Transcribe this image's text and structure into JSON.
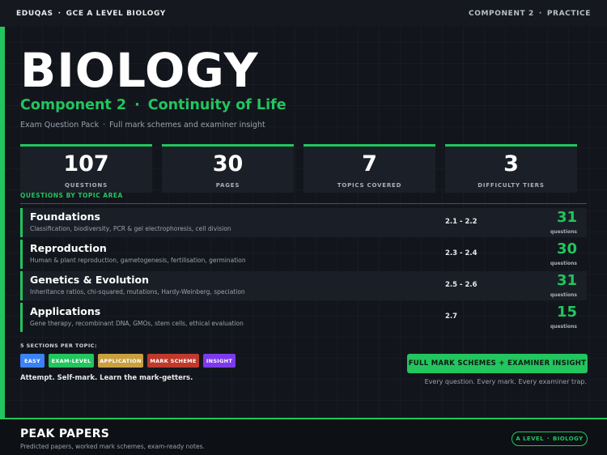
{
  "topbar": {
    "left_a": "EDUQAS",
    "left_b": "GCE A LEVEL BIOLOGY",
    "right_a": "COMPONENT 2",
    "right_b": "PRACTICE",
    "separator": "·"
  },
  "hero": {
    "title": "BIOLOGY",
    "subtitle_a": "Component 2",
    "subtitle_b": "Continuity of Life",
    "tagline_a": "Exam Question Pack",
    "tagline_b": "Full mark schemes and examiner insight"
  },
  "stats": [
    {
      "value": "107",
      "label": "QUESTIONS"
    },
    {
      "value": "30",
      "label": "PAGES"
    },
    {
      "value": "7",
      "label": "TOPICS COVERED"
    },
    {
      "value": "3",
      "label": "DIFFICULTY TIERS"
    }
  ],
  "topics_heading": "QUESTIONS BY TOPIC AREA",
  "topics": [
    {
      "name": "Foundations",
      "desc": "Classification, biodiversity, PCR & gel electrophoresis, cell division",
      "range": "2.1 - 2.2",
      "count": "31",
      "count_label": "questions"
    },
    {
      "name": "Reproduction",
      "desc": "Human & plant reproduction, gametogenesis, fertilisation, germination",
      "range": "2.3 - 2.4",
      "count": "30",
      "count_label": "questions"
    },
    {
      "name": "Genetics & Evolution",
      "desc": "Inheritance ratios, chi-squared, mutations, Hardy-Weinberg, speciation",
      "range": "2.5 - 2.6",
      "count": "31",
      "count_label": "questions"
    },
    {
      "name": "Applications",
      "desc": "Gene therapy, recombinant DNA, GMOs, stem cells, ethical evaluation",
      "range": "2.7",
      "count": "15",
      "count_label": "questions"
    }
  ],
  "sections_label": "5 SECTIONS PER TOPIC:",
  "pills": [
    {
      "label": "EASY",
      "color": "#3b82f6"
    },
    {
      "label": "EXAM-LEVEL",
      "color": "#22c55e"
    },
    {
      "label": "APPLICATION",
      "color": "#c9a040"
    },
    {
      "label": "MARK SCHEME",
      "color": "#c0392b"
    },
    {
      "label": "INSIGHT",
      "color": "#7c3aed"
    }
  ],
  "motto": "Attempt. Self-mark. Learn the mark-getters.",
  "cta": {
    "label": "FULL MARK SCHEMES + EXAMINER INSIGHT",
    "sub": "Every question. Every mark. Every examiner trap."
  },
  "footer": {
    "brand": "PEAK PAPERS",
    "brand_sub": "Predicted papers, worked mark schemes, exam-ready notes.",
    "badge_a": "A LEVEL",
    "badge_b": "BIOLOGY"
  },
  "colors": {
    "accent": "#22c55e",
    "background": "#12161c"
  }
}
